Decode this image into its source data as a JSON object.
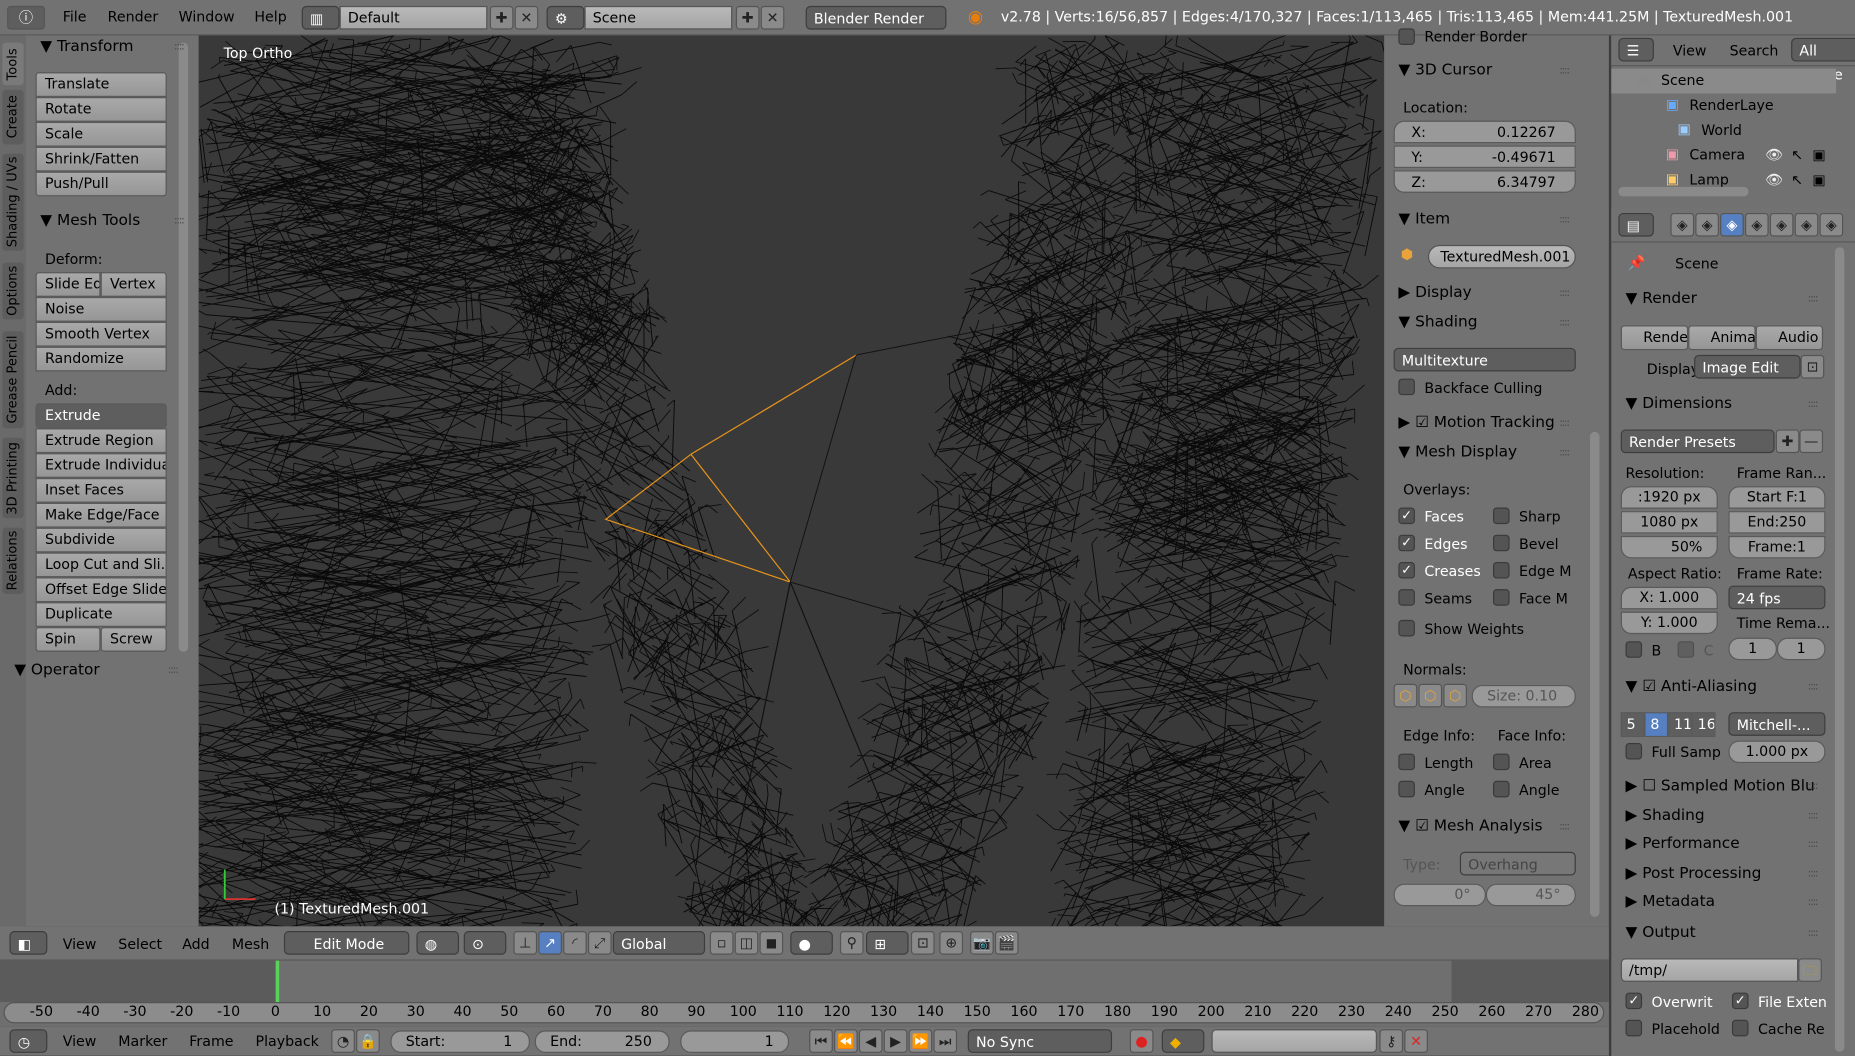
{
  "topbar": {
    "menus": [
      "File",
      "Render",
      "Window",
      "Help"
    ],
    "layout": "Default",
    "scene": "Scene",
    "engine": "Blender Render",
    "stats": "v2.78 | Verts:16/56,857 | Edges:4/170,327 | Faces:1/113,465 | Tris:113,465 | Mem:441.25M | TexturedMesh.001"
  },
  "toolshelf": {
    "tabs": [
      "Tools",
      "Create",
      "Shading / UVs",
      "Options",
      "Grease Pencil",
      "3D Printing",
      "Relations"
    ],
    "transform": {
      "title": "Transform",
      "buttons": [
        "Translate",
        "Rotate",
        "Scale",
        "Shrink/Fatten",
        "Push/Pull"
      ]
    },
    "mesh_tools": {
      "title": "Mesh Tools",
      "deform_label": "Deform:",
      "deform": [
        [
          "Slide Ed",
          "Vertex"
        ],
        [
          "Noise"
        ],
        [
          "Smooth Vertex"
        ],
        [
          "Randomize"
        ]
      ],
      "add_label": "Add:",
      "extrude": "Extrude",
      "add": [
        "Extrude Region",
        "Extrude Individual",
        "Inset Faces",
        "Make Edge/Face",
        "Subdivide",
        "Loop Cut and Sli...",
        "Offset Edge Slide",
        "Duplicate"
      ],
      "spin": "Spin",
      "screw": "Screw"
    },
    "operator": "Operator"
  },
  "viewport": {
    "view_name": "Top Ortho",
    "object_label": "(1) TexturedMesh.001",
    "selection_color": "#e8941a"
  },
  "npanel": {
    "render_border": "Render Border",
    "cursor": {
      "title": "3D Cursor",
      "location": "Location:",
      "x": "X:",
      "xv": "0.12267",
      "y": "Y:",
      "yv": "-0.49671",
      "z": "Z:",
      "zv": "6.34797"
    },
    "item": {
      "title": "Item",
      "name": "TexturedMesh.001"
    },
    "display": "Display",
    "shading": {
      "title": "Shading",
      "mode": "Multitexture",
      "backface": "Backface Culling"
    },
    "motion_tracking": "Motion Tracking",
    "mesh_display": {
      "title": "Mesh Display",
      "overlays": "Overlays:",
      "left": [
        [
          "Faces",
          true
        ],
        [
          "Edges",
          true
        ],
        [
          "Creases",
          true
        ],
        [
          "Seams",
          false
        ]
      ],
      "right": [
        [
          "Sharp",
          false
        ],
        [
          "Bevel",
          false
        ],
        [
          "Edge M",
          false
        ],
        [
          "Face M",
          false
        ]
      ],
      "show_weights": "Show Weights",
      "normals": "Normals:",
      "size": "Size: 0.10",
      "edge_info": "Edge Info:",
      "face_info": "Face Info:",
      "length": "Length",
      "angle": "Angle",
      "area": "Area",
      "angle2": "Angle"
    },
    "mesh_analysis": {
      "title": "Mesh Analysis",
      "type_label": "Type:",
      "type": "Overhang",
      "min": "0°",
      "max": "45°"
    }
  },
  "outliner": {
    "menus": [
      "View",
      "Search"
    ],
    "filter": "All Scene",
    "items": [
      "Scene",
      "RenderLaye",
      "World",
      "Camera",
      "Lamp"
    ]
  },
  "properties": {
    "context": "Scene",
    "render": {
      "title": "Render",
      "buttons": [
        "Rende",
        "Animat",
        "Audio"
      ],
      "display_label": "Display:",
      "display": "Image Edit"
    },
    "dimensions": {
      "title": "Dimensions",
      "presets": "Render Presets",
      "resolution": "Resolution:",
      "frame_range": "Frame Ran...",
      "resx": ":1920 px",
      "resy": "1080 px",
      "pct": "50%",
      "start": "Start F:1",
      "end": "End:250",
      "frame": "Frame:1",
      "aspect": "Aspect Ratio:",
      "frame_rate": "Frame Rate:",
      "ax": "X: 1.000",
      "ay": "Y: 1.000",
      "fps": "24 fps",
      "time_remap": "Time Rema...",
      "b": "B",
      "c": "C",
      "remap_old": "1",
      "remap_new": "1"
    },
    "aa": {
      "title": "Anti-Aliasing",
      "samples": [
        "5",
        "8",
        "11",
        "16"
      ],
      "selected": "8",
      "filter": "Mitchell-...",
      "full_sample": "Full Samp",
      "size": "1.000 px"
    },
    "collapsed": [
      "Sampled Motion Blu",
      "Shading",
      "Performance",
      "Post Processing",
      "Metadata"
    ],
    "output": {
      "title": "Output",
      "path": "/tmp/",
      "overwrite": "Overwrit",
      "file_ext": "File Exten",
      "placeholder": "Placehold",
      "cache": "Cache Re"
    }
  },
  "view3d_header": {
    "menus": [
      "View",
      "Select",
      "Add",
      "Mesh"
    ],
    "mode": "Edit Mode",
    "orientation": "Global"
  },
  "timeline": {
    "ticks": [
      "-50",
      "-40",
      "-30",
      "-20",
      "-10",
      "0",
      "10",
      "20",
      "30",
      "40",
      "50",
      "60",
      "70",
      "80",
      "90",
      "100",
      "110",
      "120",
      "130",
      "140",
      "150",
      "160",
      "170",
      "180",
      "190",
      "200",
      "210",
      "220",
      "230",
      "240",
      "250",
      "260",
      "270",
      "280"
    ],
    "current_frame": 0,
    "menus": [
      "View",
      "Marker",
      "Frame",
      "Playback"
    ],
    "start": "Start:",
    "start_v": "1",
    "end": "End:",
    "end_v": "250",
    "current": "1",
    "sync": "No Sync"
  },
  "colors": {
    "accent": "#5680c2",
    "header": "#727272",
    "viewport": "#393939"
  }
}
